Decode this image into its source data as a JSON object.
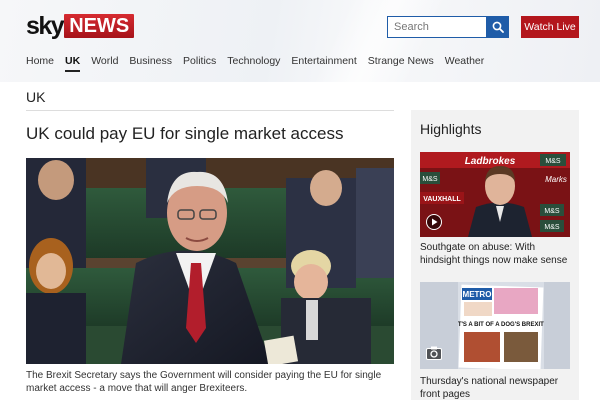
{
  "brand": {
    "sky": "sky",
    "news": "NEWS"
  },
  "search": {
    "placeholder": "Search"
  },
  "header": {
    "watch_live_label": "Watch Live"
  },
  "nav": {
    "items": [
      "Home",
      "UK",
      "World",
      "Business",
      "Politics",
      "Technology",
      "Entertainment",
      "Strange News",
      "Weather"
    ],
    "active": "UK"
  },
  "section": {
    "title": "UK"
  },
  "article": {
    "headline": "UK could pay EU for single market access",
    "caption": "The Brexit Secretary says the Government will consider paying the EU for single market access - a move that will anger Brexiteers."
  },
  "highlights": {
    "title": "Highlights",
    "items": [
      {
        "caption": "Southgate on abuse: With hindsight things now make sense",
        "icon": "video-play-icon"
      },
      {
        "caption": "Thursday's national newspaper front pages",
        "icon": "camera-icon"
      }
    ]
  },
  "photo_text": {
    "banner1": "Ladbrokes",
    "board_labels": [
      "M&S",
      "M&S",
      "Marks",
      "VAUXHALL",
      "M&S",
      "M&S"
    ],
    "paper_mast": "METRO",
    "paper_headline": "IT'S A BIT OF A DOG'S BREXIT"
  },
  "colors": {
    "brand_red": "#b3161c",
    "search_blue": "#1f5ca8",
    "highlight_bg": "#f2f2f2"
  }
}
